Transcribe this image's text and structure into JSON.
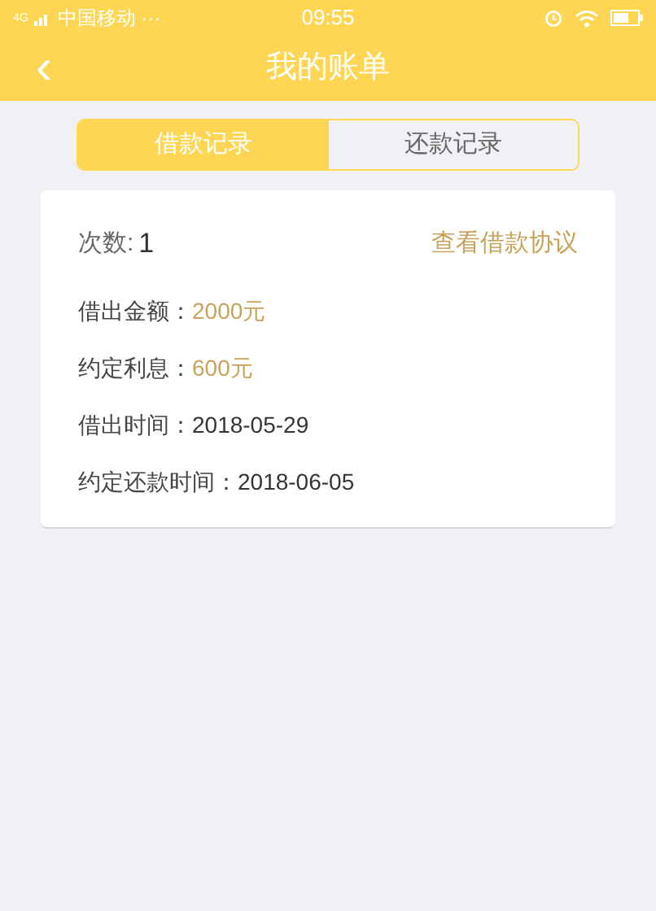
{
  "status_bar": {
    "carrier": "中国移动 ···",
    "signal_label": "4G",
    "time": "09:55"
  },
  "nav": {
    "back": "‹",
    "title": "我的账单"
  },
  "tabs": [
    {
      "label": "借款记录",
      "selected": true
    },
    {
      "label": "还款记录",
      "selected": false
    }
  ],
  "card": {
    "count_label": "次数:",
    "count": "1",
    "link": "查看借款协议",
    "rows": [
      {
        "label": "借出金额：",
        "value": "2000元",
        "kind": "amount"
      },
      {
        "label": "约定利息：",
        "value": "600元",
        "kind": "amount"
      },
      {
        "label": "借出时间：",
        "value": "2018-05-29",
        "kind": "plain"
      },
      {
        "label": "约定还款时间：",
        "value": "2018-06-05",
        "kind": "plain"
      }
    ]
  }
}
